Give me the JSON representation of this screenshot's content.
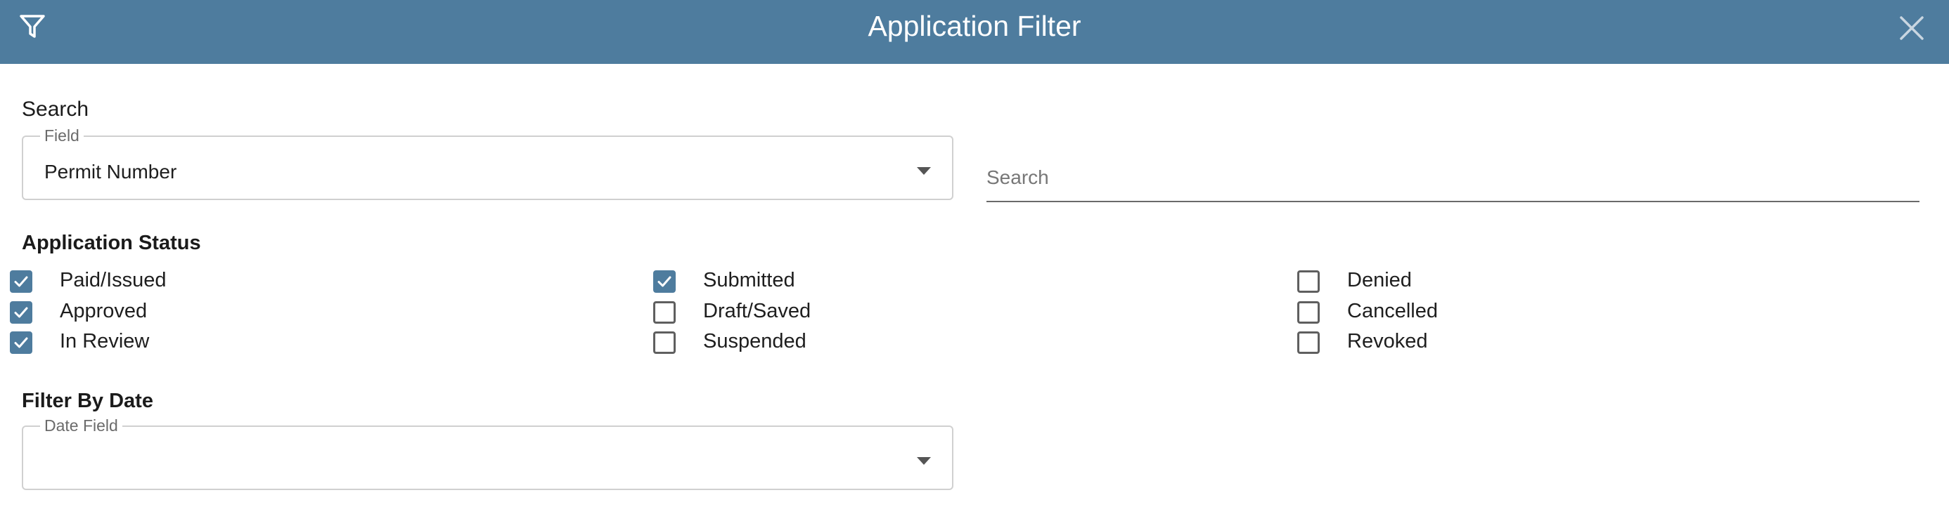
{
  "header": {
    "title": "Application Filter",
    "filter_icon": "filter-icon",
    "close_icon": "close-icon"
  },
  "search": {
    "label": "Search",
    "field": {
      "legend": "Field",
      "value": "Permit Number"
    },
    "input": {
      "placeholder": "Search",
      "value": ""
    }
  },
  "status": {
    "label": "Application Status",
    "items": [
      {
        "label": "Paid/Issued",
        "checked": true
      },
      {
        "label": "Approved",
        "checked": true
      },
      {
        "label": "In Review",
        "checked": true
      },
      {
        "label": "Submitted",
        "checked": true
      },
      {
        "label": "Draft/Saved",
        "checked": false
      },
      {
        "label": "Suspended",
        "checked": false
      },
      {
        "label": "Denied",
        "checked": false
      },
      {
        "label": "Cancelled",
        "checked": false
      },
      {
        "label": "Revoked",
        "checked": false
      }
    ]
  },
  "date": {
    "label": "Filter By Date",
    "field": {
      "legend": "Date Field",
      "value": ""
    }
  },
  "colors": {
    "accent": "#4e7c9e",
    "checkbox_border": "#5f5f5f"
  }
}
